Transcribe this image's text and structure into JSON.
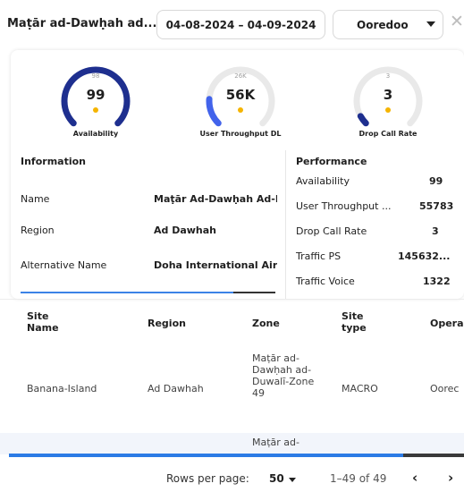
{
  "header": {
    "location_title": "Maṭār ad-Dawḥah ad...",
    "date_range": "04-08-2024 – 04-09-2024",
    "operator": "Ooredoo",
    "close_icon": "close-icon",
    "caret_icon": "chevron-down-icon"
  },
  "gauges": [
    {
      "max": "98",
      "value": "99",
      "label": "Availability",
      "fill": 1.0,
      "color": "#1e2f8f"
    },
    {
      "max": "26K",
      "value": "56K",
      "label": "User Throughput DL",
      "fill": 0.18,
      "color": "#4263eb"
    },
    {
      "max": "3",
      "value": "3",
      "label": "Drop Call Rate",
      "fill": 0.06,
      "color": "#1e2f8f"
    }
  ],
  "information": {
    "title": "Information",
    "rows": [
      {
        "label": "Name",
        "value": "Maṭār Ad-Dawḥah Ad-Duwalī"
      },
      {
        "label": "Region",
        "value": "Ad Dawhah"
      },
      {
        "label": "Alternative Name",
        "value": "Doha International Airport"
      }
    ]
  },
  "performance": {
    "title": "Performance",
    "rows": [
      {
        "label": "Availability",
        "value": "99"
      },
      {
        "label": "User Throughput ...",
        "value": "55783"
      },
      {
        "label": "Drop Call Rate",
        "value": "3"
      },
      {
        "label": "Traffic PS",
        "value": "145632..."
      },
      {
        "label": "Traffic Voice",
        "value": "1322"
      }
    ]
  },
  "table": {
    "columns": [
      "Site\nName",
      "Region",
      "Zone",
      "Site\ntype",
      "Opera"
    ],
    "rows": [
      {
        "site_name": "Banana-Island",
        "region": "Ad Dawhah",
        "zone": "Maṭār ad-Dawḥah ad-Duwalī-Zone 49",
        "site_type": "MACRO",
        "operator": "Oorec"
      },
      {
        "zone": "Maṭār ad-"
      }
    ]
  },
  "pagination": {
    "rows_label": "Rows per page:",
    "rows_value": "50",
    "range": "1–49 of 49",
    "prev": "‹",
    "next": "›"
  }
}
